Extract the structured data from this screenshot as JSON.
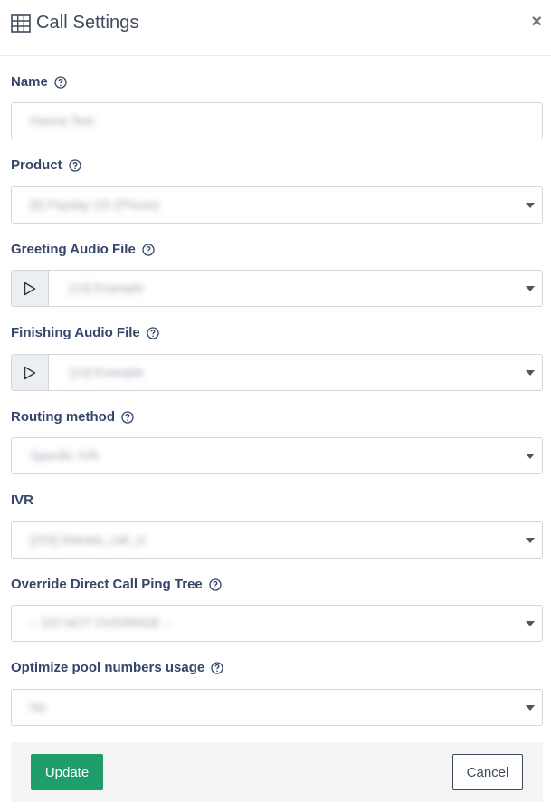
{
  "header": {
    "title": "Call Settings",
    "title_icon": "table-icon",
    "close_glyph": "×"
  },
  "fields": {
    "name": {
      "label": "Name",
      "value": "Hanna Test"
    },
    "product": {
      "label": "Product",
      "value": "[0] Payday US (Phone)"
    },
    "greeting_audio": {
      "label": "Greeting Audio File",
      "value": "[13] Example"
    },
    "finishing_audio": {
      "label": "Finishing Audio File",
      "value": "[13] Example"
    },
    "routing_method": {
      "label": "Routing method",
      "value": "Specific IVR"
    },
    "ivr": {
      "label": "IVR",
      "value": "[253] Mahala_call_in"
    },
    "override_ping_tree": {
      "label": "Override Direct Call Ping Tree",
      "value": "-- DO NOT OVERRIDE --"
    },
    "optimize_pool": {
      "label": "Optimize pool numbers usage",
      "value": "No"
    }
  },
  "footer": {
    "update_label": "Update",
    "cancel_label": "Cancel"
  },
  "colors": {
    "primary": "#1e9e6b",
    "label": "#34466a",
    "border": "#d3d7dc"
  }
}
